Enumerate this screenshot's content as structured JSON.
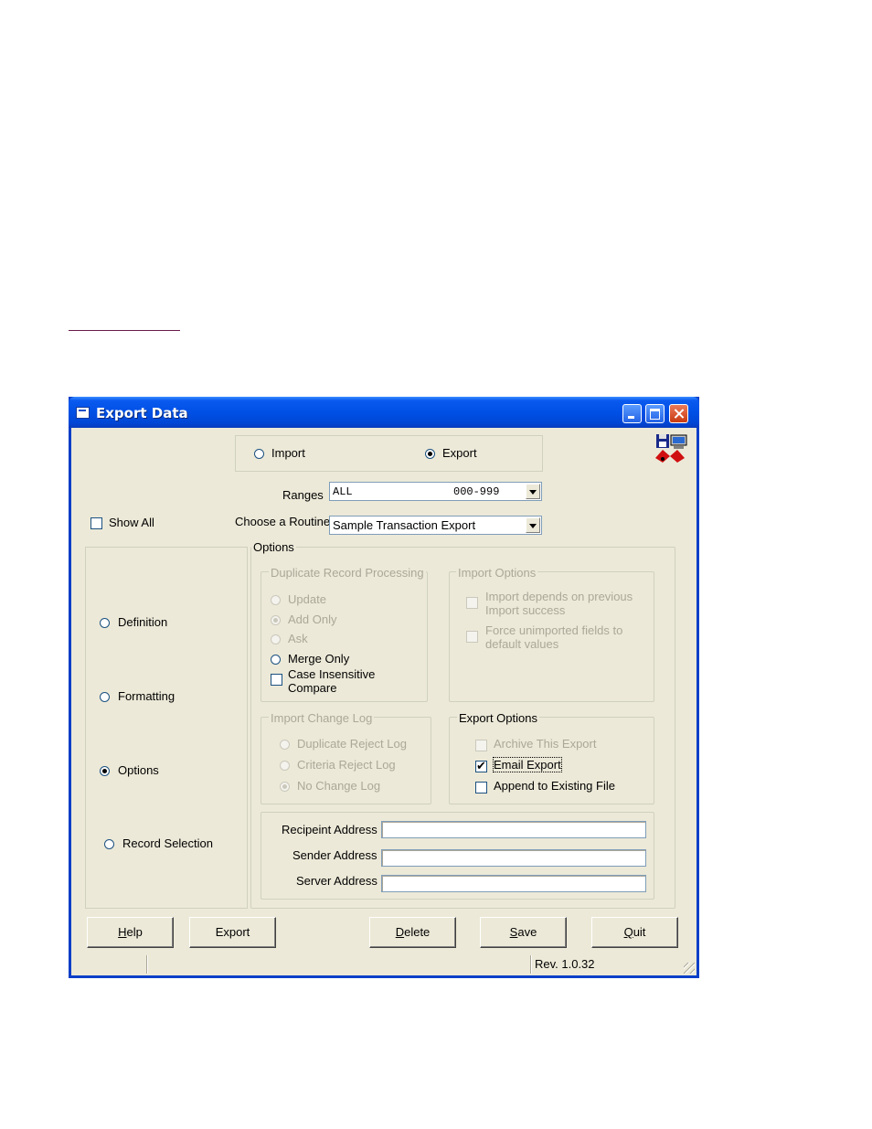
{
  "window": {
    "title": "Export Data"
  },
  "mode": {
    "import_label": "Import",
    "export_label": "Export",
    "selected": "Export"
  },
  "ranges": {
    "label": "Ranges",
    "value_left": "ALL",
    "value_right": "000-999"
  },
  "routine": {
    "label": "Choose a Routine",
    "value": "Sample Transaction Export"
  },
  "show_all": {
    "label": "Show All",
    "checked": false
  },
  "sections": [
    {
      "label": "Definition",
      "selected": false
    },
    {
      "label": "Formatting",
      "selected": false
    },
    {
      "label": "Options",
      "selected": true
    },
    {
      "label": "Record Selection",
      "selected": false
    }
  ],
  "options": {
    "title": "Options",
    "duplicate": {
      "title": "Duplicate Record Processing",
      "update": "Update",
      "add_only": "Add Only",
      "ask": "Ask",
      "merge_only": "Merge Only",
      "case_insensitive_1": "Case Insensitive",
      "case_insensitive_2": "Compare"
    },
    "import_options": {
      "title": "Import Options",
      "depends_1": "Import depends on previous",
      "depends_2": "Import success",
      "force_1": "Force unimported fields to",
      "force_2": "default values"
    },
    "change_log": {
      "title": "Import Change Log",
      "duplicate_reject": "Duplicate Reject Log",
      "criteria_reject": "Criteria Reject Log",
      "no_change": "No Change Log"
    },
    "export_options": {
      "title": "Export Options",
      "archive": "Archive This Export",
      "email": "Email Export",
      "append": "Append to Existing File"
    },
    "email": {
      "recipient_label": "Recipeint Address",
      "sender_label": "Sender Address",
      "server_label": "Server Address",
      "recipient_value": "",
      "sender_value": "",
      "server_value": ""
    }
  },
  "buttons": {
    "help_u": "H",
    "help_rest": "elp",
    "export": "Export",
    "delete_u": "D",
    "delete_rest": "elete",
    "save_u": "S",
    "save_rest": "ave",
    "quit_u": "Q",
    "quit_rest": "uit"
  },
  "status": {
    "revision": "Rev. 1.0.32"
  },
  "icons": {
    "app": "disk-computer-icon",
    "title": "window-app-icon"
  }
}
